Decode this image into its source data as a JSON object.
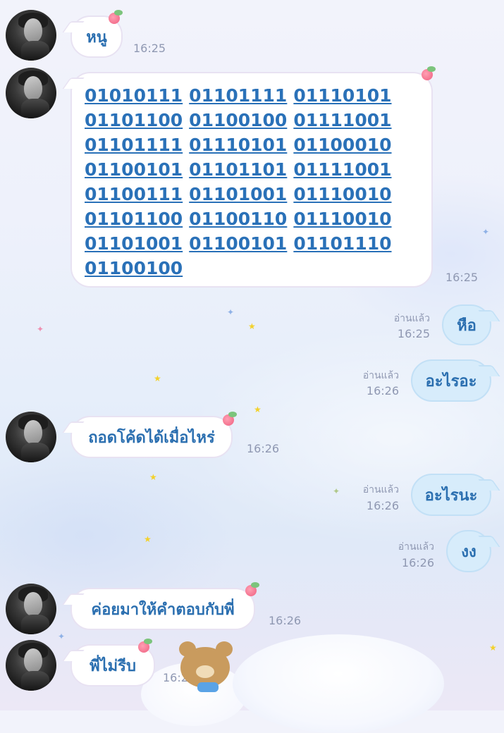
{
  "messages": [
    {
      "side": "in",
      "text": "หนู",
      "time": "16:25"
    },
    {
      "side": "in",
      "type": "binary",
      "time": "16:25",
      "lines": [
        [
          "01010111",
          "01101111",
          "01110101"
        ],
        [
          "01101100",
          "01100100",
          "01111001"
        ],
        [
          "01101111",
          "01110101",
          "01100010"
        ],
        [
          "01100101",
          "01101101",
          "01111001"
        ],
        [
          "01100111",
          "01101001",
          "01110010"
        ],
        [
          "01101100",
          "01100110",
          "01110010"
        ],
        [
          "01101001",
          "01100101",
          "01101110"
        ],
        [
          "01100100"
        ]
      ]
    },
    {
      "side": "out",
      "text": "หือ",
      "read": "อ่านแล้ว",
      "time": "16:25"
    },
    {
      "side": "out",
      "text": "อะไรอะ",
      "read": "อ่านแล้ว",
      "time": "16:26"
    },
    {
      "side": "in",
      "text": "ถอดโค้ดได้เมื่อไหร่",
      "time": "16:26"
    },
    {
      "side": "out",
      "text": "อะไรนะ",
      "read": "อ่านแล้ว",
      "time": "16:26"
    },
    {
      "side": "out",
      "text": "งง",
      "read": "อ่านแล้ว",
      "time": "16:26"
    },
    {
      "side": "in",
      "text": "ค่อยมาให้คำตอบกับพี่",
      "time": "16:26"
    },
    {
      "side": "in",
      "text": "พี่ไม่รีบ",
      "time": "16:26"
    }
  ],
  "colors": {
    "text_blue": "#2b6fb0",
    "link_blue": "#2a71b8",
    "out_bubble": "#d7ecfb",
    "time_gray": "#8f98b2"
  }
}
